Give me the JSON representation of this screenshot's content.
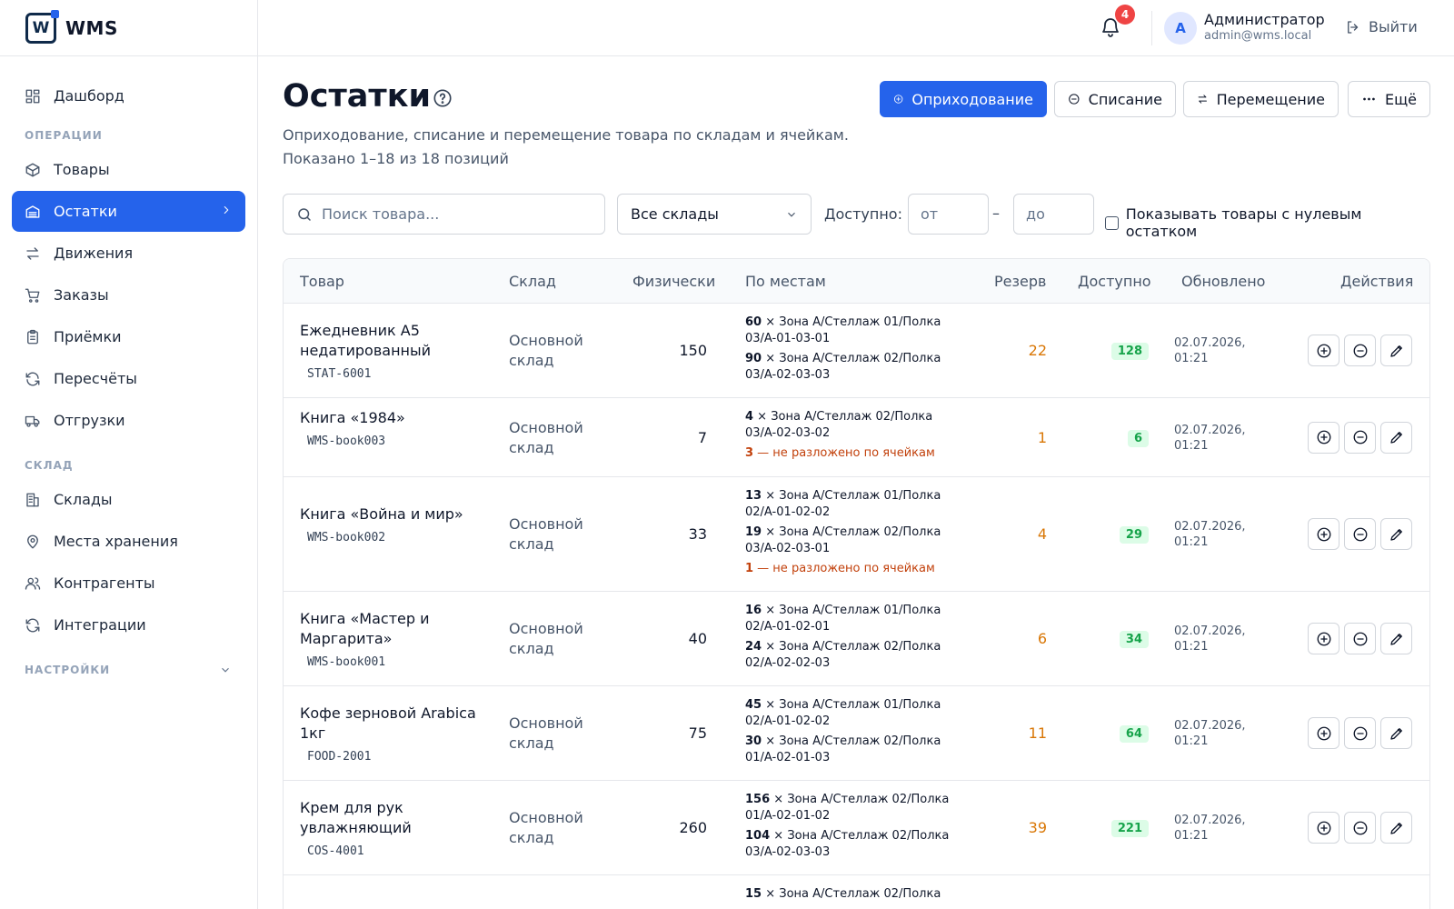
{
  "brand": {
    "logo_letter": "W",
    "name": "WMS"
  },
  "sidebar": {
    "items": [
      {
        "label": "Дашборд",
        "icon": "dashboard-icon"
      },
      {
        "label": "Товары",
        "icon": "box-icon"
      },
      {
        "label": "Остатки",
        "icon": "stock-icon",
        "active": true
      },
      {
        "label": "Движения",
        "icon": "arrows-icon"
      },
      {
        "label": "Заказы",
        "icon": "cart-icon"
      },
      {
        "label": "Приёмки",
        "icon": "clipboard-icon"
      },
      {
        "label": "Пересчёты",
        "icon": "refresh-icon"
      },
      {
        "label": "Отгрузки",
        "icon": "truck-icon"
      },
      {
        "label": "Склады",
        "icon": "building-icon"
      },
      {
        "label": "Места хранения",
        "icon": "map-pin-icon"
      },
      {
        "label": "Контрагенты",
        "icon": "users-icon"
      },
      {
        "label": "Интеграции",
        "icon": "sync-icon"
      }
    ],
    "sections": {
      "operations": "ОПЕРАЦИИ",
      "warehouse": "СКЛАД",
      "settings": "НАСТРОЙКИ"
    }
  },
  "header": {
    "notifications_count": "4",
    "avatar_letter": "A",
    "user_name": "Администратор",
    "user_email": "admin@wms.local",
    "logout_label": "Выйти"
  },
  "page": {
    "title": "Остатки",
    "subtitle": "Оприходование, списание и перемещение товара по складам и ячейкам.",
    "count_text": "Показано 1–18 из 18 позиций"
  },
  "actions": {
    "receive": "Оприходование",
    "writeoff": "Списание",
    "move": "Перемещение",
    "more": "Ещё"
  },
  "filters": {
    "search_placeholder": "Поиск товара...",
    "warehouse_selected": "Все склады",
    "available_label": "Доступно:",
    "from_placeholder": "от",
    "dash": "–",
    "to_placeholder": "до",
    "zero_stock_label": "Показывать товары с нулевым остатком"
  },
  "table": {
    "columns": {
      "product": "Товар",
      "warehouse": "Склад",
      "physical": "Физически",
      "places": "По местам",
      "reserve": "Резерв",
      "available": "Доступно",
      "updated": "Обновлено",
      "actions": "Действия"
    },
    "rows": [
      {
        "name": "Ежедневник А5 недатированный",
        "sku": "STAT-6001",
        "warehouse": "Основной склад",
        "physical": "150",
        "places": [
          {
            "qty": "60",
            "loc": "Зона A/Стеллаж 01/Полка 03/A-01-03-01"
          },
          {
            "qty": "90",
            "loc": "Зона A/Стеллаж 02/Полка 03/A-02-03-03"
          }
        ],
        "unplaced": "",
        "reserve": "22",
        "available": "128",
        "updated": "02.07.2026, 01:21"
      },
      {
        "name": "Книга «1984»",
        "sku": "WMS-book003",
        "warehouse": "Основной склад",
        "physical": "7",
        "places": [
          {
            "qty": "4",
            "loc": "Зона A/Стеллаж 02/Полка 03/A-02-03-02"
          }
        ],
        "unplaced": "3 — не разложено по ячейкам",
        "reserve": "1",
        "available": "6",
        "updated": "02.07.2026, 01:21"
      },
      {
        "name": "Книга «Война и мир»",
        "sku": "WMS-book002",
        "warehouse": "Основной склад",
        "physical": "33",
        "places": [
          {
            "qty": "13",
            "loc": "Зона A/Стеллаж 01/Полка 02/A-01-02-02"
          },
          {
            "qty": "19",
            "loc": "Зона A/Стеллаж 02/Полка 03/A-02-03-01"
          }
        ],
        "unplaced": "1 — не разложено по ячейкам",
        "reserve": "4",
        "available": "29",
        "updated": "02.07.2026, 01:21"
      },
      {
        "name": "Книга «Мастер и Маргарита»",
        "sku": "WMS-book001",
        "warehouse": "Основной склад",
        "physical": "40",
        "places": [
          {
            "qty": "16",
            "loc": "Зона A/Стеллаж 01/Полка 02/A-01-02-01"
          },
          {
            "qty": "24",
            "loc": "Зона A/Стеллаж 02/Полка 02/A-02-02-03"
          }
        ],
        "unplaced": "",
        "reserve": "6",
        "available": "34",
        "updated": "02.07.2026, 01:21"
      },
      {
        "name": "Кофе зерновой Arabica 1кг",
        "sku": "FOOD-2001",
        "warehouse": "Основной склад",
        "physical": "75",
        "places": [
          {
            "qty": "45",
            "loc": "Зона A/Стеллаж 01/Полка 02/A-01-02-02"
          },
          {
            "qty": "30",
            "loc": "Зона A/Стеллаж 02/Полка 01/A-02-01-03"
          }
        ],
        "unplaced": "",
        "reserve": "11",
        "available": "64",
        "updated": "02.07.2026, 01:21"
      },
      {
        "name": "Крем для рук увлажняющий",
        "sku": "COS-4001",
        "warehouse": "Основной склад",
        "physical": "260",
        "places": [
          {
            "qty": "156",
            "loc": "Зона A/Стеллаж 02/Полка 01/A-02-01-02"
          },
          {
            "qty": "104",
            "loc": "Зона A/Стеллаж 02/Полка 03/A-02-03-03"
          }
        ],
        "unplaced": "",
        "reserve": "39",
        "available": "221",
        "updated": "02.07.2026, 01:21"
      },
      {
        "name": "",
        "sku": "",
        "warehouse": "",
        "physical": "",
        "places": [
          {
            "qty": "15",
            "loc": "Зона A/Стеллаж 02/Полка"
          }
        ],
        "unplaced": "",
        "reserve": "",
        "available": "",
        "updated": ""
      }
    ]
  }
}
